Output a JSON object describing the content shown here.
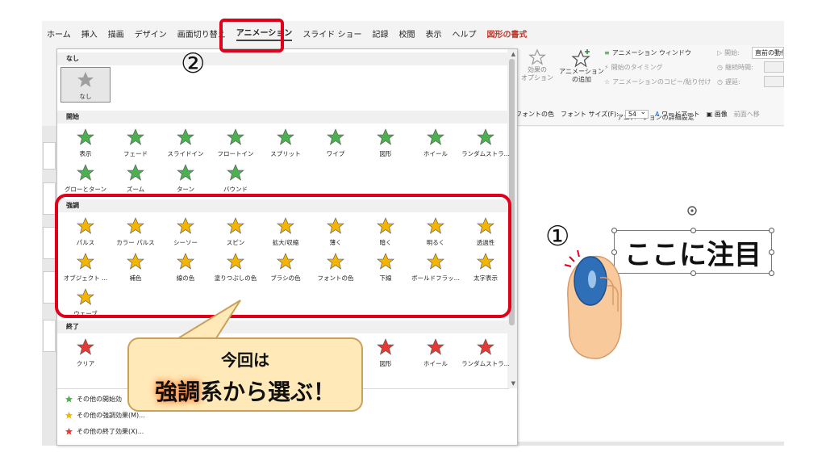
{
  "menu": {
    "tabs": [
      "ホーム",
      "挿入",
      "描画",
      "デザイン",
      "画面切り替え",
      "アニメーション",
      "スライド ショー",
      "記録",
      "校閲",
      "表示",
      "ヘルプ",
      "図形の書式"
    ],
    "active": "アニメーション",
    "context_tab": "図形の書式"
  },
  "ribbon": {
    "effect_options": "効果の\nオプション",
    "add_animation": "アニメーション\nの追加",
    "animation_pane": "アニメーション ウィンドウ",
    "trigger": "開始のタイミング",
    "animation_painter": "アニメーションのコピー/貼り付け",
    "advanced_group": "アニメーションの詳細設定",
    "start_label": "開始:",
    "start_value": "直前の動作",
    "duration_label": "継続時間:",
    "delay_label": "遅延:"
  },
  "format_bar": {
    "font_color": "フォントの色",
    "font_size_label": "フォント サイズ(F):",
    "font_size_value": "54",
    "wordart": "ワードアート",
    "image": "画像",
    "bring_forward": "前面へ移"
  },
  "gallery": {
    "none_section": "なし",
    "none_item": "なし",
    "entrance_section": "開始",
    "entrance_items": [
      "表示",
      "フェード",
      "スライドイン",
      "フロートイン",
      "スプリット",
      "ワイプ",
      "図形",
      "ホイール",
      "ランダムストラ...",
      "グローとターン",
      "ズーム",
      "ターン",
      "バウンド"
    ],
    "emphasis_section": "強調",
    "emphasis_items": [
      "パルス",
      "カラー パルス",
      "シーソー",
      "スピン",
      "拡大/収縮",
      "薄く",
      "暗く",
      "明るく",
      "透過性",
      "オブジェクト ...",
      "補色",
      "線の色",
      "塗りつぶしの色",
      "ブラシの色",
      "フォントの色",
      "下線",
      "ボールドフラッ...",
      "太字表示",
      "ウェーブ"
    ],
    "exit_section": "終了",
    "exit_items": [
      "クリア",
      "図形",
      "ホイール",
      "ランダムストラ..."
    ],
    "more_entrance": "その他の開始効",
    "more_emphasis": "その他の強調効果(M)...",
    "more_exit": "その他の終了効果(X)..."
  },
  "annotations": {
    "step1": "①",
    "step2": "②",
    "callout_line1": "今回は",
    "callout_highlight": "強調",
    "callout_rest": "系から選ぶ！"
  },
  "slide": {
    "text": "ここに注目"
  },
  "colors": {
    "accent_red": "#e0001a",
    "entrance_star": "#4caf50",
    "emphasis_star": "#f4b400",
    "exit_star": "#e53935",
    "callout_fill": "#ffe9b8"
  }
}
